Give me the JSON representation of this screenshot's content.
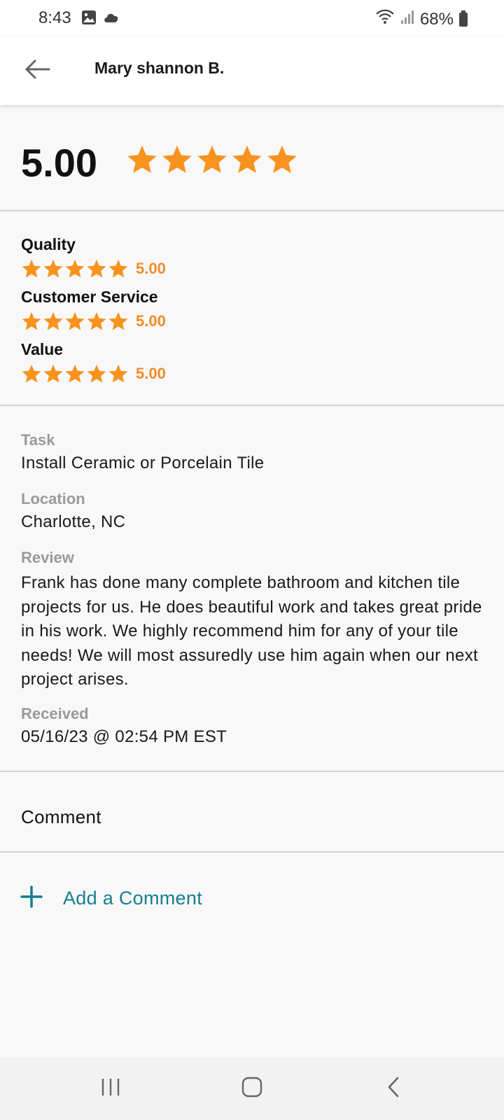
{
  "status_bar": {
    "time": "8:43",
    "battery": "68%",
    "icons": [
      "image-icon",
      "cloud-icon",
      "wifi-icon",
      "signal-icon",
      "battery-icon"
    ]
  },
  "header": {
    "back_icon": "arrow-left-icon",
    "title": "Mary shannon B."
  },
  "overall": {
    "score": "5.00",
    "stars": 5
  },
  "ratings": [
    {
      "label": "Quality",
      "score": "5.00",
      "stars": 5
    },
    {
      "label": "Customer Service",
      "score": "5.00",
      "stars": 5
    },
    {
      "label": "Value",
      "score": "5.00",
      "stars": 5
    }
  ],
  "details": {
    "task_label": "Task",
    "task_value": "Install Ceramic or Porcelain Tile",
    "location_label": "Location",
    "location_value": "Charlotte, NC",
    "review_label": "Review",
    "review_value": "Frank has done many complete bathroom and kitchen tile projects for us. He does beautiful work and takes great pride in his work. We highly recommend him for any of your tile needs! We will most assuredly use him again when our next project arises.",
    "received_label": "Received",
    "received_value": "05/16/23 @ 02:54 PM EST"
  },
  "comment": {
    "heading": "Comment",
    "add_label": "Add a Comment",
    "add_icon": "plus-icon"
  },
  "nav": {
    "icons": [
      "recent-apps-icon",
      "home-icon",
      "back-icon"
    ]
  },
  "colors": {
    "star": "#f7931e",
    "score_accent": "#f28c28",
    "link": "#157e8f",
    "label_gray": "#9a9a9a"
  }
}
